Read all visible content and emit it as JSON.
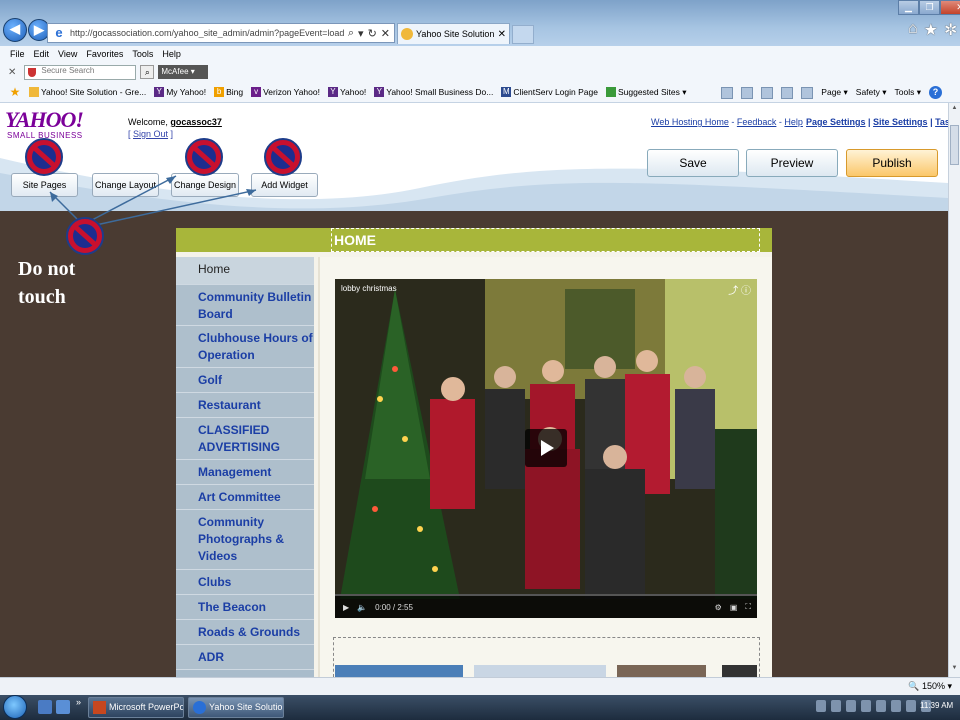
{
  "browser": {
    "url": "http://gocassociation.com/yahoo_site_admin/admin?pageEvent=load-dialog+/_ySm",
    "tab_title": "Yahoo Site Solution ...",
    "menu": [
      "File",
      "Edit",
      "View",
      "Favorites",
      "Tools",
      "Help"
    ],
    "search_placeholder": "Secure Search",
    "mcafee": "McAfee",
    "favorites": [
      {
        "label": "Yahoo! Site Solution - Gre...",
        "icon": "ie-page-icon",
        "color": "#f0b83a"
      },
      {
        "label": "My Yahoo!",
        "icon": "yahoo-icon",
        "color": "#5b2a86"
      },
      {
        "label": "Bing",
        "icon": "bing-icon",
        "color": "#f0a000"
      },
      {
        "label": "Verizon Yahoo!",
        "icon": "verizon-icon",
        "color": "#6b1f8a"
      },
      {
        "label": "Yahoo!",
        "icon": "yahoo-icon",
        "color": "#5b2a86"
      },
      {
        "label": "Yahoo! Small Business Do...",
        "icon": "yahoo-icon",
        "color": "#5b2a86"
      },
      {
        "label": "ClientServ Login Page",
        "icon": "ms-icon",
        "color": "#2c4a8f"
      },
      {
        "label": "Suggested Sites ▾",
        "icon": "ie-page-icon",
        "color": "#3a9a3a"
      }
    ],
    "tools": {
      "page": "Page ▾",
      "safety": "Safety ▾",
      "tools": "Tools ▾",
      "help": "?"
    }
  },
  "builder": {
    "logo": "YAHOO!",
    "logo_sub": "SMALL BUSINESS",
    "welcome_prefix": "Welcome, ",
    "username": "gocassoc37",
    "sign_out": "Sign Out",
    "links": {
      "web_hosting_home": "Web Hosting Home",
      "feedback": "Feedback",
      "help": "Help",
      "page_settings": "Page Settings",
      "site_settings": "Site Settings",
      "tasks": "Tasks"
    },
    "buttons": {
      "save": "Save",
      "preview": "Preview",
      "publish": "Publish",
      "site_pages": "Site Pages",
      "change_layout": "Change Layout",
      "change_design": "Change Design",
      "add_widget": "Add Widget"
    }
  },
  "annotation": {
    "line1": "Do not",
    "line2": "touch"
  },
  "site": {
    "section_title": "HOME",
    "nav": [
      "Home",
      "Community Bulletin Board",
      "Clubhouse Hours of Operation",
      "Golf",
      "Restaurant",
      "CLASSIFIED ADVERTISING",
      "Management",
      "Art Committee",
      "Community Photographs & Videos",
      "Clubs",
      "The Beacon",
      "Roads & Grounds",
      "ADR"
    ],
    "video": {
      "title": "lobby christmas",
      "time": "0:00 / 2:55"
    }
  },
  "status": {
    "zoom": "🔍 150% ▾"
  },
  "taskbar": {
    "tasks": [
      "Microsoft PowerPoin...",
      "Yahoo Site Solution -..."
    ],
    "clock": "11:39 AM"
  }
}
